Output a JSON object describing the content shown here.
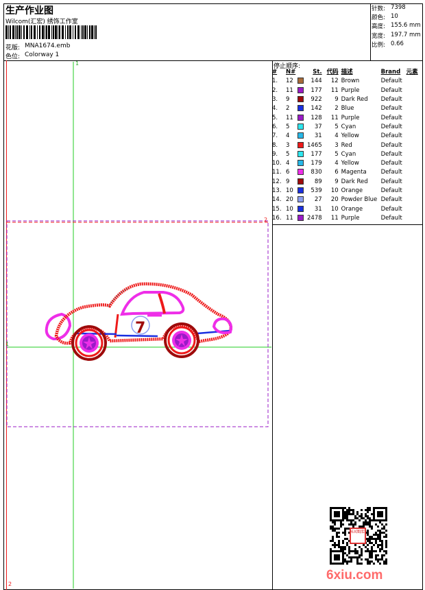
{
  "header": {
    "title": "生产作业图",
    "company": "Wilcom(汇宏) 绣饰工作室",
    "design_label": "花版:",
    "design_value": "MNA1674.emb",
    "colorway_label": "色位:",
    "colorway_value": "Colorway 1"
  },
  "stats": [
    {
      "label": "针数:",
      "value": "7398"
    },
    {
      "label": "颜色:",
      "value": "10"
    },
    {
      "label": "高度:",
      "value": "155.6 mm"
    },
    {
      "label": "宽度:",
      "value": "197.7 mm"
    },
    {
      "label": "比例:",
      "value": "0.66"
    }
  ],
  "stop_sequence": {
    "title": "停止顺序:",
    "headers": {
      "idx": "#",
      "needle": "N#",
      "stitches": "St.",
      "code": "代码",
      "desc": "描述",
      "brand": "Brand",
      "element": "元素"
    },
    "rows": [
      {
        "idx": "1.",
        "needle": "12",
        "color": "#a86b3a",
        "stitches": "144",
        "code": "12",
        "desc": "Brown",
        "brand": "Default"
      },
      {
        "idx": "2.",
        "needle": "11",
        "color": "#9a1bc7",
        "stitches": "177",
        "code": "11",
        "desc": "Purple",
        "brand": "Default"
      },
      {
        "idx": "3.",
        "needle": "9",
        "color": "#9e0b0b",
        "stitches": "922",
        "code": "9",
        "desc": "Dark Red",
        "brand": "Default"
      },
      {
        "idx": "4.",
        "needle": "2",
        "color": "#1a2fe0",
        "stitches": "142",
        "code": "2",
        "desc": "Blue",
        "brand": "Default"
      },
      {
        "idx": "5.",
        "needle": "11",
        "color": "#9a1bc7",
        "stitches": "128",
        "code": "11",
        "desc": "Purple",
        "brand": "Default"
      },
      {
        "idx": "6.",
        "needle": "5",
        "color": "#2ee6ee",
        "stitches": "37",
        "code": "5",
        "desc": "Cyan",
        "brand": "Default"
      },
      {
        "idx": "7.",
        "needle": "4",
        "color": "#27b8e8",
        "stitches": "31",
        "code": "4",
        "desc": "Yellow",
        "brand": "Default"
      },
      {
        "idx": "8.",
        "needle": "3",
        "color": "#ee1a1a",
        "stitches": "1465",
        "code": "3",
        "desc": "Red",
        "brand": "Default"
      },
      {
        "idx": "9.",
        "needle": "5",
        "color": "#2ee6ee",
        "stitches": "177",
        "code": "5",
        "desc": "Cyan",
        "brand": "Default"
      },
      {
        "idx": "10.",
        "needle": "4",
        "color": "#27b8e8",
        "stitches": "179",
        "code": "4",
        "desc": "Yellow",
        "brand": "Default"
      },
      {
        "idx": "11.",
        "needle": "6",
        "color": "#ee2ee8",
        "stitches": "830",
        "code": "6",
        "desc": "Magenta",
        "brand": "Default"
      },
      {
        "idx": "12.",
        "needle": "9",
        "color": "#9e0b0b",
        "stitches": "89",
        "code": "9",
        "desc": "Dark Red",
        "brand": "Default"
      },
      {
        "idx": "13.",
        "needle": "10",
        "color": "#1a2fe0",
        "stitches": "539",
        "code": "10",
        "desc": "Orange",
        "brand": "Default"
      },
      {
        "idx": "14.",
        "needle": "20",
        "color": "#8c9ef0",
        "stitches": "27",
        "code": "20",
        "desc": "Powder Blue",
        "brand": "Default"
      },
      {
        "idx": "15.",
        "needle": "10",
        "color": "#1a2fe0",
        "stitches": "31",
        "code": "10",
        "desc": "Orange",
        "brand": "Default"
      },
      {
        "idx": "16.",
        "needle": "11",
        "color": "#9a1bc7",
        "stitches": "2478",
        "code": "11",
        "desc": "Purple",
        "brand": "Default"
      }
    ]
  },
  "canvas": {
    "marker_1_top": "1",
    "marker_1_left": "1",
    "marker_2_right": "2",
    "marker_2_bottom": "2",
    "car_number": "7",
    "guide_color": "#22cc22",
    "frame_color": "#9a1bc7",
    "car_red": "#ee1a1a",
    "car_magenta": "#ee2ee8",
    "car_blue": "#1a2fe0"
  },
  "watermark": {
    "site": "6xiu.com",
    "seal_text": "6X图库"
  }
}
